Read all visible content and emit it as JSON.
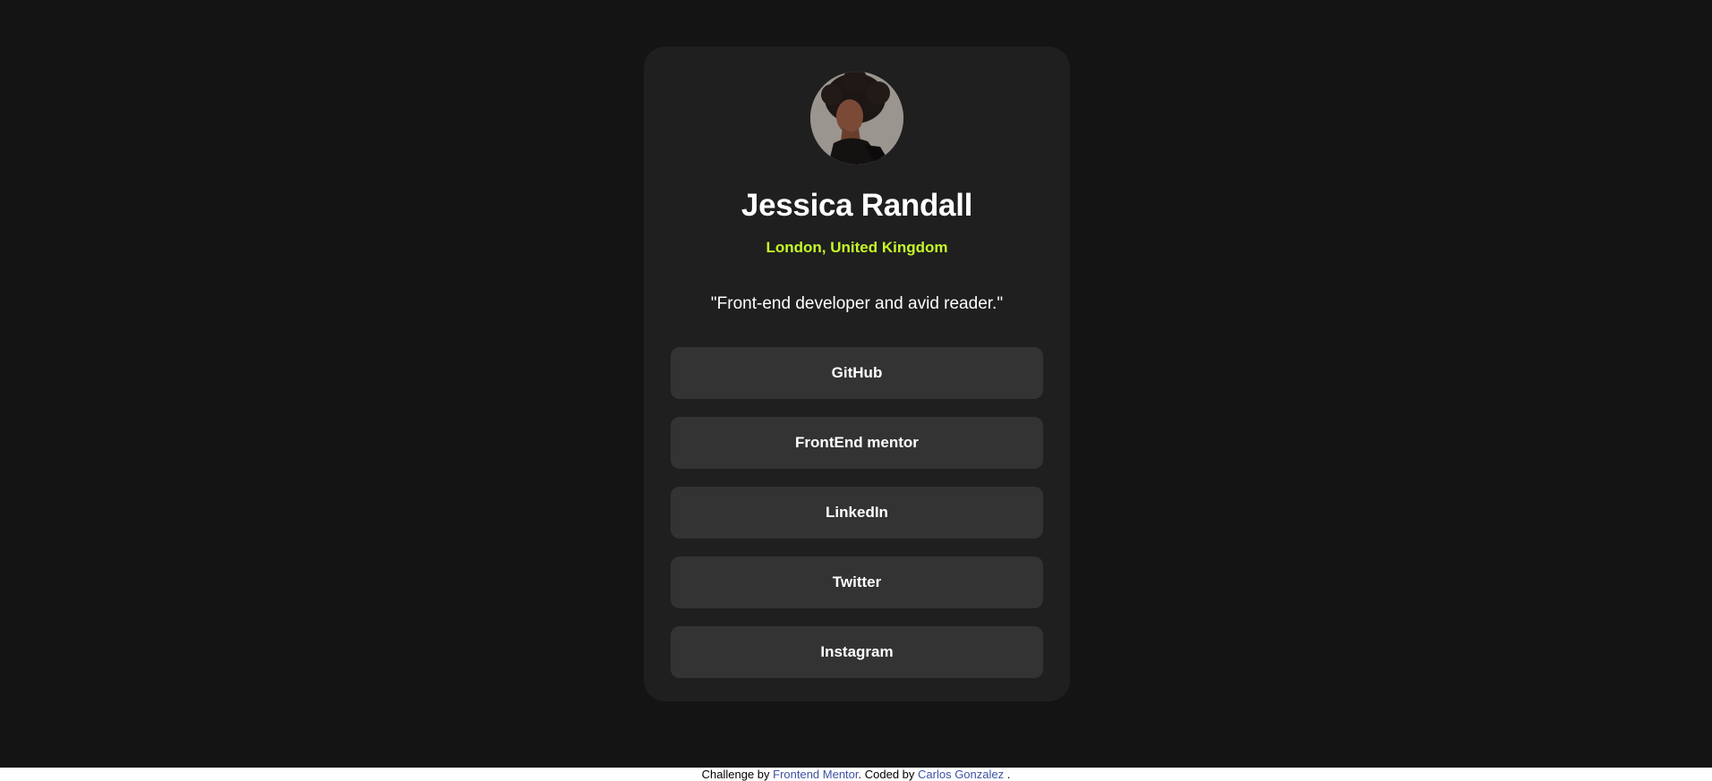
{
  "profile": {
    "name": "Jessica Randall",
    "location": "London, United Kingdom",
    "bio": "\"Front-end developer and avid reader.\""
  },
  "links": [
    {
      "label": "GitHub"
    },
    {
      "label": "FrontEnd mentor"
    },
    {
      "label": "LinkedIn"
    },
    {
      "label": "Twitter"
    },
    {
      "label": "Instagram"
    }
  ],
  "attribution": {
    "prefix": "Challenge by ",
    "challenge_link": "Frontend Mentor",
    "middle": ". Coded by ",
    "author_link": "Carlos Gonzalez",
    "suffix": " ."
  },
  "colors": {
    "page_background": "#141414",
    "card_background": "#1f1f1f",
    "button_background": "#333333",
    "accent": "#c4f82a",
    "text": "#ffffff",
    "link": "#3e52a3"
  }
}
